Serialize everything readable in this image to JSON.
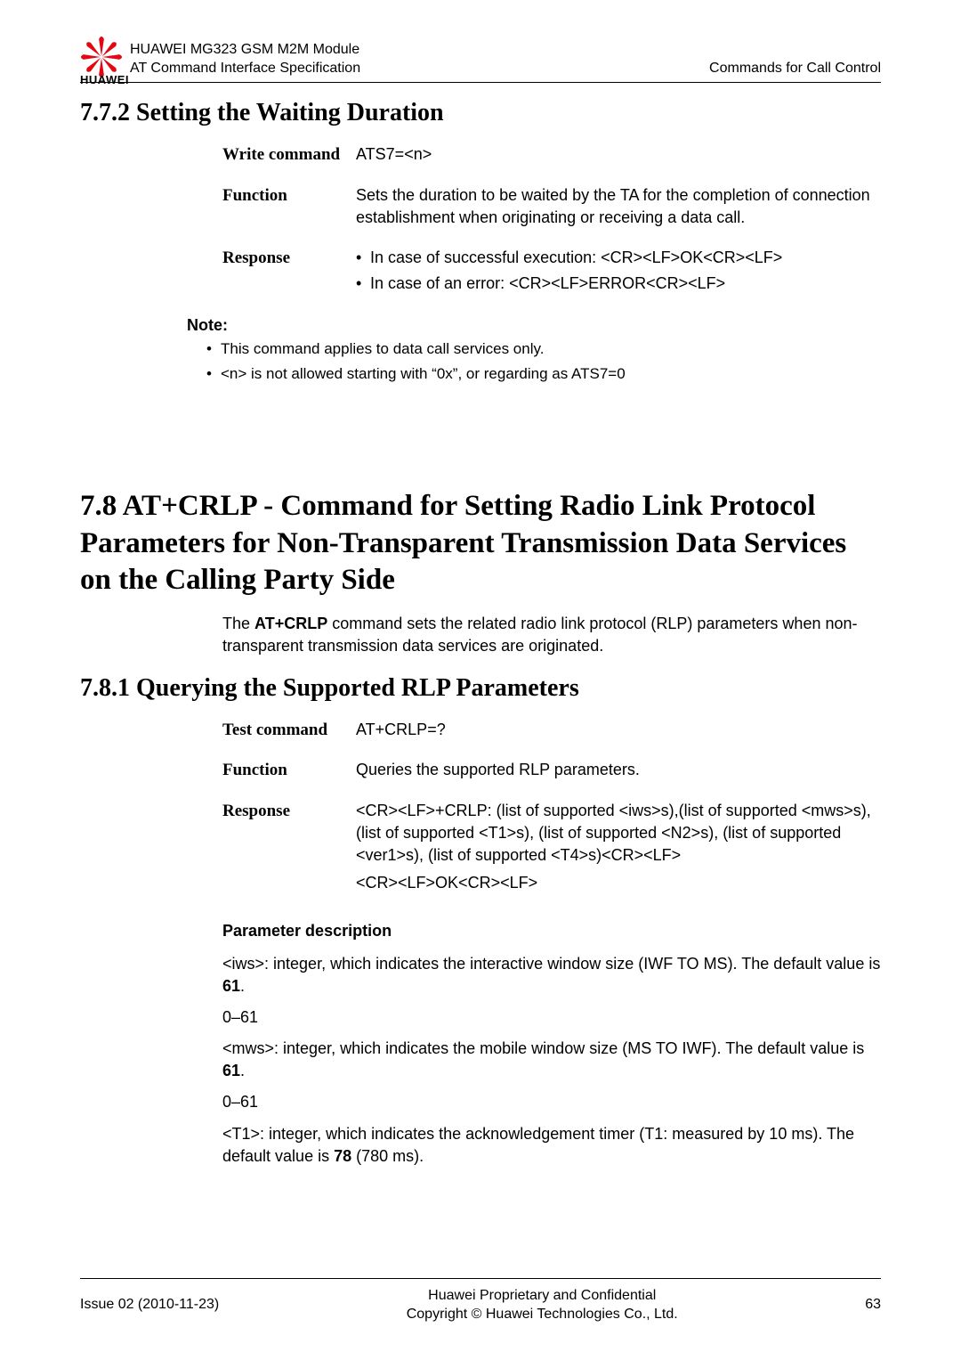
{
  "header": {
    "brand": "HUAWEI",
    "line1": "HUAWEI MG323 GSM M2M Module",
    "line2": "AT Command Interface Specification",
    "right": "Commands for Call Control"
  },
  "s772": {
    "title": "7.7.2 Setting the Waiting Duration",
    "rows": {
      "write_label": "Write command",
      "write_value": "ATS7=<n>",
      "function_label": "Function",
      "function_value": "Sets the duration to be waited by the TA for the completion of connection establishment when originating or receiving a data call.",
      "response_label": "Response",
      "response_b1": "In case of successful execution: <CR><LF>OK<CR><LF>",
      "response_b2": "In case of an error: <CR><LF>ERROR<CR><LF>"
    },
    "note_title": "Note:",
    "note_b1": "This command applies to data call services only.",
    "note_b2": "<n> is not allowed starting with   “0x”, or regarding as ATS7=0"
  },
  "s78": {
    "title": "7.8 AT+CRLP - Command for Setting Radio Link Protocol Parameters for Non-Transparent Transmission Data Services on the Calling Party Side",
    "intro_pre": "The ",
    "intro_cmd": "AT+CRLP",
    "intro_post": " command sets the related radio link protocol (RLP) parameters when non-transparent transmission data services are originated."
  },
  "s781": {
    "title": "7.8.1 Querying the Supported RLP Parameters",
    "rows": {
      "test_label": "Test command",
      "test_value": "AT+CRLP=?",
      "function_label": "Function",
      "function_value": "Queries the supported RLP parameters.",
      "response_label": "Response",
      "response_value1": "<CR><LF>+CRLP: (list of supported <iws>s),(list of supported <mws>s), (list of supported <T1>s), (list of supported <N2>s), (list of supported <ver1>s), (list of supported <T4>s)<CR><LF>",
      "response_value2": "<CR><LF>OK<CR><LF>"
    },
    "param_heading": "Parameter description",
    "p1a": "<iws>: integer, which indicates the interactive window size (IWF TO MS). The default value is ",
    "p1b": "61",
    "p1c": ".",
    "range1": "0–61",
    "p2a": "<mws>: integer, which indicates the mobile window size (MS TO IWF). The default value is ",
    "p2b": "61",
    "p2c": ".",
    "range2": "0–61",
    "p3a": "<T1>: integer, which indicates the acknowledgement timer (T1: measured by 10 ms). The default value is ",
    "p3b": "78",
    "p3c": " (780 ms)."
  },
  "footer": {
    "left": "Issue 02 (2010-11-23)",
    "center1": "Huawei Proprietary and Confidential",
    "center2": "Copyright © Huawei Technologies Co., Ltd.",
    "right": "63"
  }
}
